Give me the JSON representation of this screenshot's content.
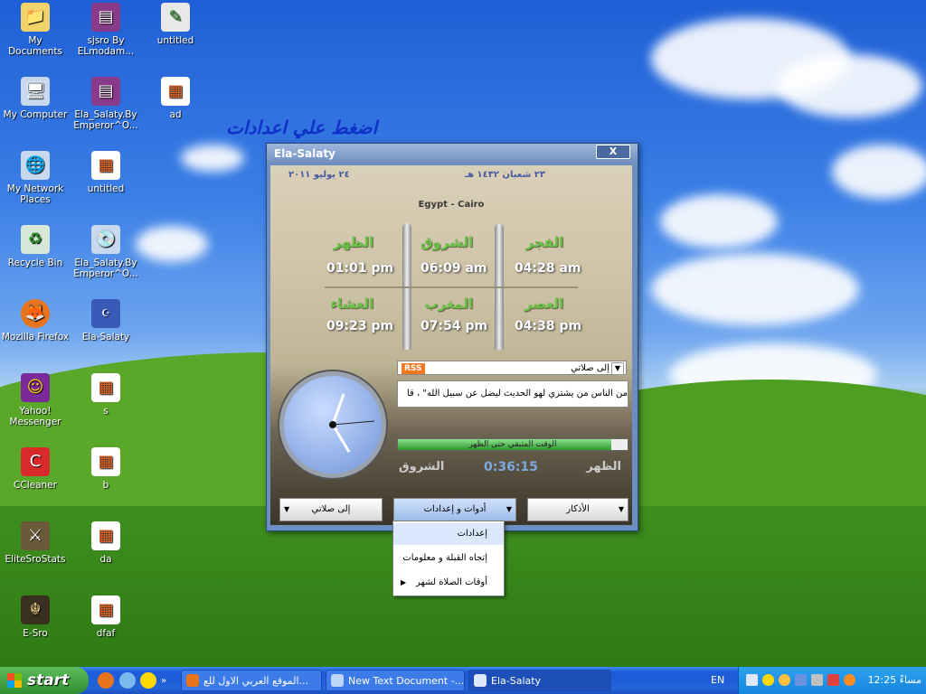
{
  "desktop": {
    "hint_text": "اضغط علي اعدادات",
    "icons": [
      {
        "label": "My Documents"
      },
      {
        "label": "sjsro By ELmodam..."
      },
      {
        "label": "untitled"
      },
      {
        "label": "My Computer"
      },
      {
        "label": "Ela_Salaty.By Emperor^O..."
      },
      {
        "label": "ad"
      },
      {
        "label": "My Network Places"
      },
      {
        "label": "untitled"
      },
      {
        "label": "Recycle Bin"
      },
      {
        "label": "Ela_Salaty.By Emperor^O..."
      },
      {
        "label": "Mozilla Firefox"
      },
      {
        "label": "Ela-Salaty"
      },
      {
        "label": "Yahoo! Messenger"
      },
      {
        "label": "s"
      },
      {
        "label": "CCleaner"
      },
      {
        "label": "b"
      },
      {
        "label": "EliteSroStats"
      },
      {
        "label": "da"
      },
      {
        "label": "E-Sro"
      },
      {
        "label": "dfaf"
      }
    ]
  },
  "app": {
    "title": "Ela-Salaty",
    "close_label": "X",
    "hijri_date": "٢٣ شعبان ١٤٣٢ هـ",
    "gregorian_date": "٢٤ يوليو ٢٠١١",
    "city": "Egypt - Cairo",
    "prayers": [
      {
        "name": "الفجر",
        "time": "04:28 am"
      },
      {
        "name": "الشروق",
        "time": "06:09 am"
      },
      {
        "name": "الظهر",
        "time": "01:01 pm"
      },
      {
        "name": "العصر",
        "time": "04:38 pm"
      },
      {
        "name": "المغرب",
        "time": "07:54 pm"
      },
      {
        "name": "العشاء",
        "time": "09:23 pm"
      }
    ],
    "feed_select": "إلى صلاتي",
    "rss_badge": "RSS",
    "ticker_text": "من الناس من يشتري لهو الحديث ليضل عن سبيل الله\" ، قا",
    "progress_label": "الوقت المتبقي حتى الظهر",
    "progress": 0.93,
    "countdown": "0:36:15",
    "previous_event": "الشروق",
    "next_event": "الظهر",
    "buttons": {
      "left": "إلى صلاتي",
      "middle": "أدوات و إعدادات",
      "right": "الأذكار"
    },
    "menu": [
      {
        "label": "إعدادات"
      },
      {
        "label": "إتجاه القبلة و معلومات"
      },
      {
        "label": "أوقات الصلاة لشهر"
      }
    ]
  },
  "taskbar": {
    "start_label": "start",
    "tasks": [
      {
        "label": "الموقع العربي الاول للع..."
      },
      {
        "label": "New Text Document -..."
      },
      {
        "label": "Ela-Salaty"
      }
    ],
    "language": "EN",
    "clock": "12:25 مساءً"
  }
}
